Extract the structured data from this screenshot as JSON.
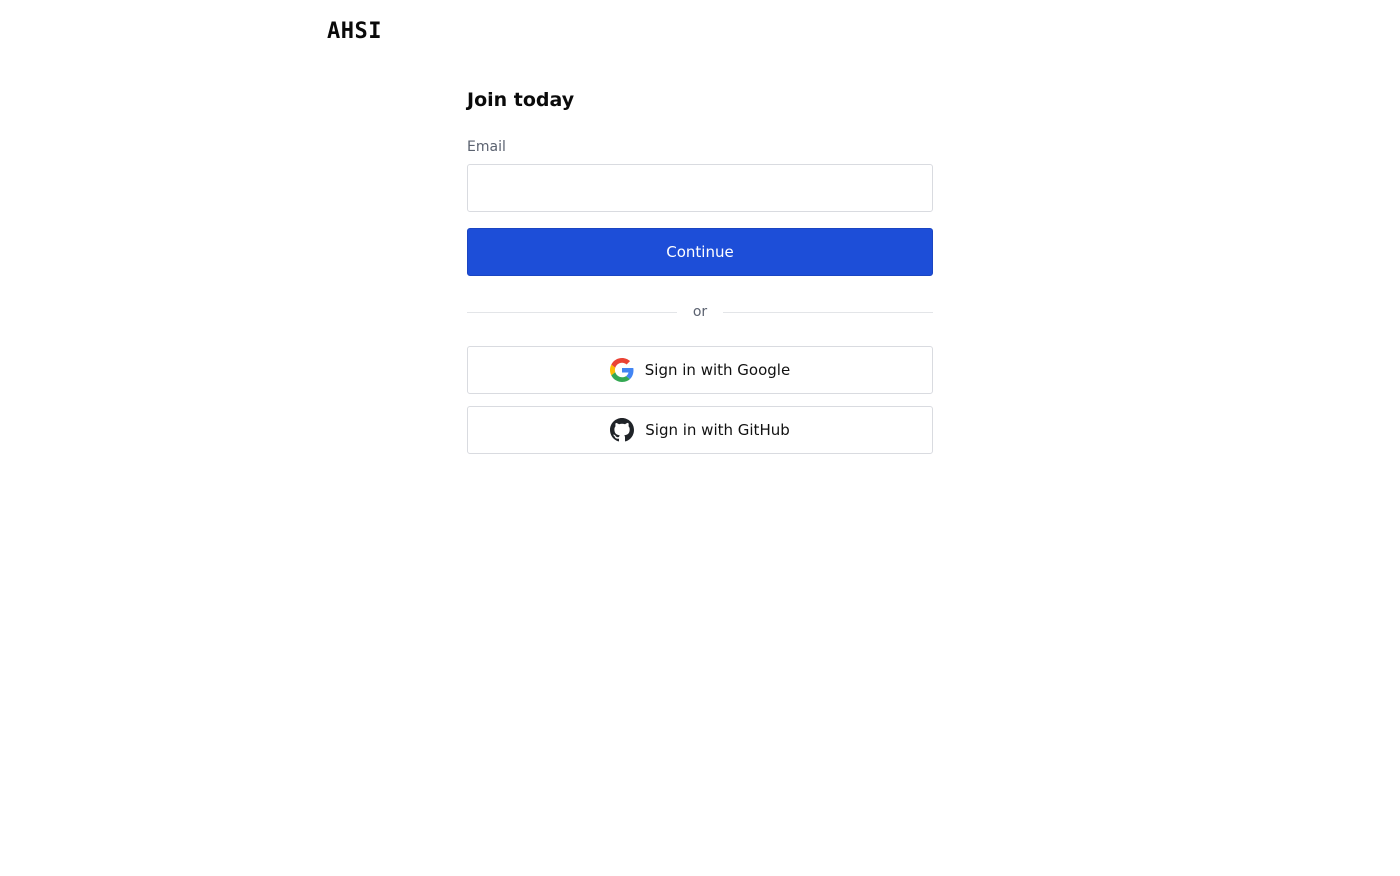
{
  "brand": {
    "logo_text": "AHSI"
  },
  "form": {
    "heading": "Join today",
    "email_label": "Email",
    "email_value": "",
    "email_placeholder": "",
    "continue_label": "Continue",
    "divider_text": "or",
    "google_label": "Sign in with Google",
    "google_icon": "google-icon",
    "github_label": "Sign in with GitHub",
    "github_icon": "github-icon"
  },
  "colors": {
    "primary": "#1d4ed8",
    "text": "#111111",
    "muted": "#5b6270",
    "border": "#d9dbe0"
  }
}
